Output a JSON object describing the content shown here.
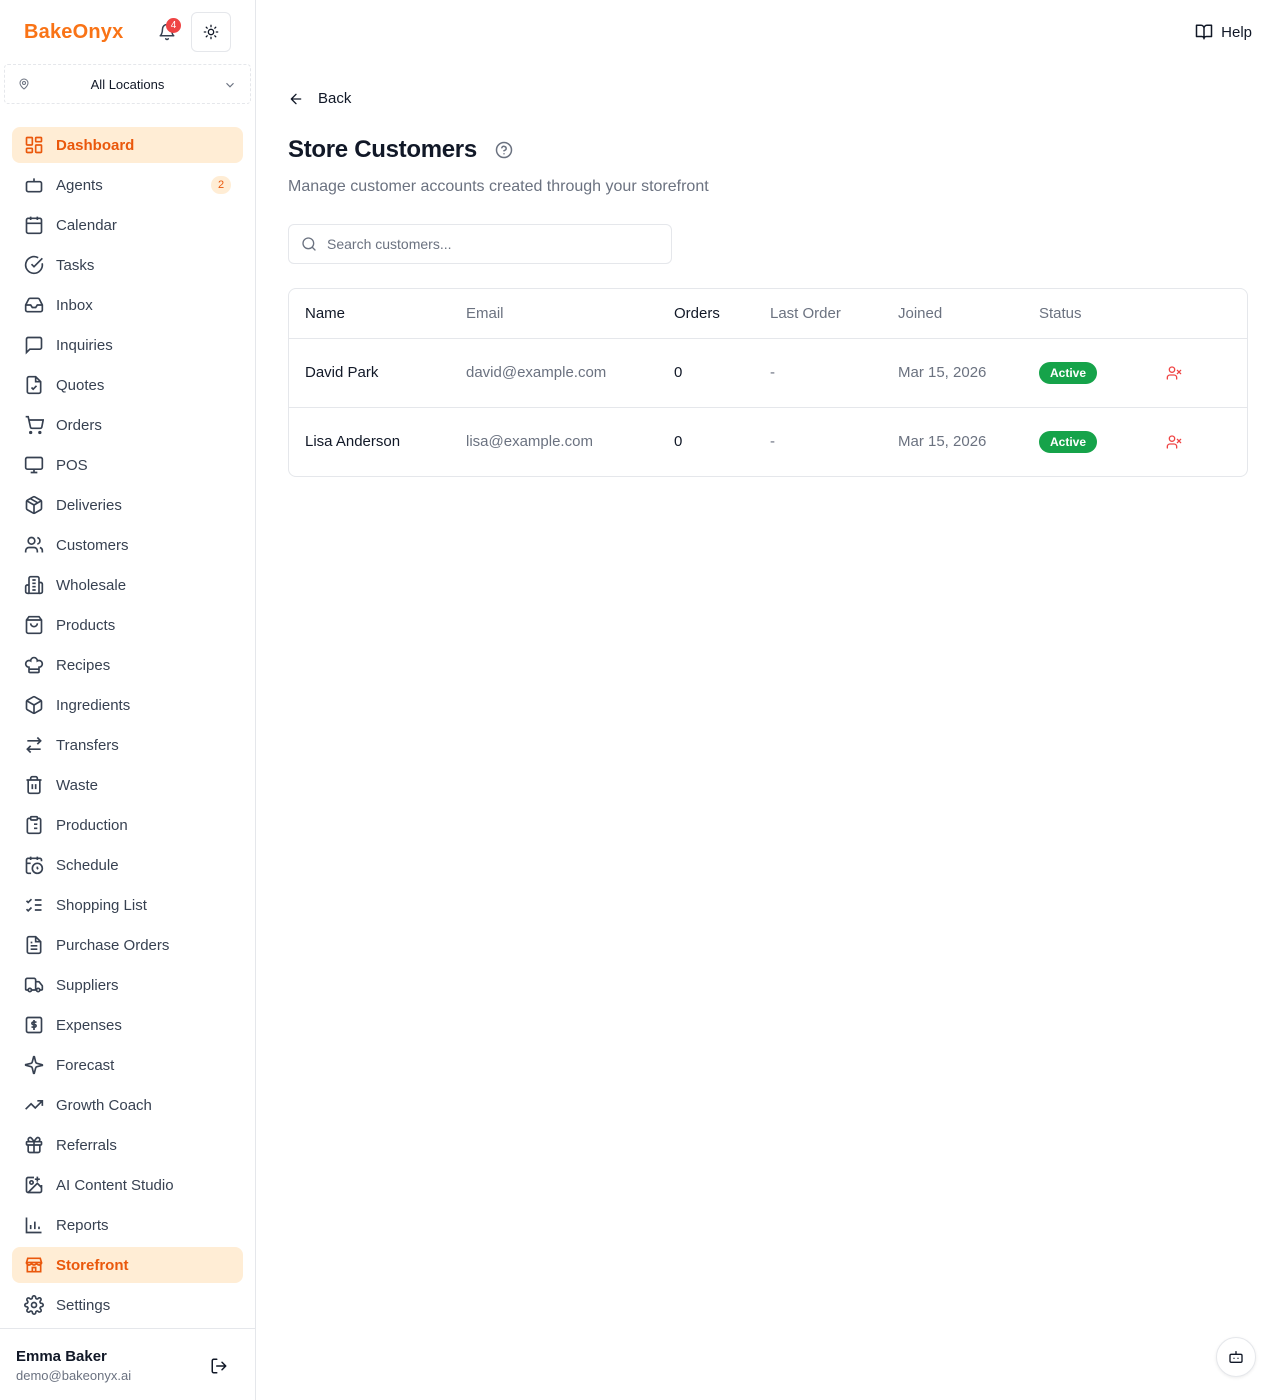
{
  "app": {
    "brand": "BakeOnyx",
    "notifications_count": "4",
    "accent": "#f97316"
  },
  "location": {
    "selected": "All Locations"
  },
  "sidebar": {
    "items": [
      {
        "label": "Dashboard",
        "icon": "dashboard-icon"
      },
      {
        "label": "Agents",
        "icon": "bot-icon",
        "badge": "2"
      },
      {
        "label": "Calendar",
        "icon": "calendar-icon"
      },
      {
        "label": "Tasks",
        "icon": "check-circle-icon"
      },
      {
        "label": "Inbox",
        "icon": "inbox-icon"
      },
      {
        "label": "Inquiries",
        "icon": "message-icon"
      },
      {
        "label": "Quotes",
        "icon": "file-check-icon"
      },
      {
        "label": "Orders",
        "icon": "cart-icon"
      },
      {
        "label": "POS",
        "icon": "monitor-icon"
      },
      {
        "label": "Deliveries",
        "icon": "package-icon"
      },
      {
        "label": "Customers",
        "icon": "users-icon"
      },
      {
        "label": "Wholesale",
        "icon": "building-icon"
      },
      {
        "label": "Products",
        "icon": "shopping-bag-icon"
      },
      {
        "label": "Recipes",
        "icon": "chef-hat-icon"
      },
      {
        "label": "Ingredients",
        "icon": "box-icon"
      },
      {
        "label": "Transfers",
        "icon": "arrows-icon"
      },
      {
        "label": "Waste",
        "icon": "trash-icon"
      },
      {
        "label": "Production",
        "icon": "clipboard-icon"
      },
      {
        "label": "Schedule",
        "icon": "calendar-clock-icon"
      },
      {
        "label": "Shopping List",
        "icon": "list-checks-icon"
      },
      {
        "label": "Purchase Orders",
        "icon": "file-text-icon"
      },
      {
        "label": "Suppliers",
        "icon": "truck-icon"
      },
      {
        "label": "Expenses",
        "icon": "dollar-icon"
      },
      {
        "label": "Forecast",
        "icon": "sparkles-icon"
      },
      {
        "label": "Growth Coach",
        "icon": "trending-up-icon"
      },
      {
        "label": "Referrals",
        "icon": "gift-icon"
      },
      {
        "label": "AI Content Studio",
        "icon": "image-plus-icon"
      },
      {
        "label": "Reports",
        "icon": "bar-chart-icon"
      },
      {
        "label": "Storefront",
        "icon": "store-icon"
      },
      {
        "label": "Settings",
        "icon": "gear-icon"
      }
    ]
  },
  "user": {
    "name": "Emma Baker",
    "email": "demo@bakeonyx.ai"
  },
  "header": {
    "help_label": "Help"
  },
  "page": {
    "back_label": "Back",
    "title": "Store Customers",
    "subtitle": "Manage customer accounts created through your storefront",
    "search_placeholder": "Search customers..."
  },
  "table": {
    "columns": [
      "Name",
      "Email",
      "Orders",
      "Last Order",
      "Joined",
      "Status"
    ],
    "rows": [
      {
        "name": "David Park",
        "email": "david@example.com",
        "orders": "0",
        "last_order": "-",
        "joined": "Mar 15, 2026",
        "status": "Active"
      },
      {
        "name": "Lisa Anderson",
        "email": "lisa@example.com",
        "orders": "0",
        "last_order": "-",
        "joined": "Mar 15, 2026",
        "status": "Active"
      }
    ]
  },
  "colors": {
    "active_nav_bg": "#ffedd5",
    "active_nav_text": "#ea580c",
    "status_active": "#16a34a",
    "danger": "#ef4444"
  }
}
